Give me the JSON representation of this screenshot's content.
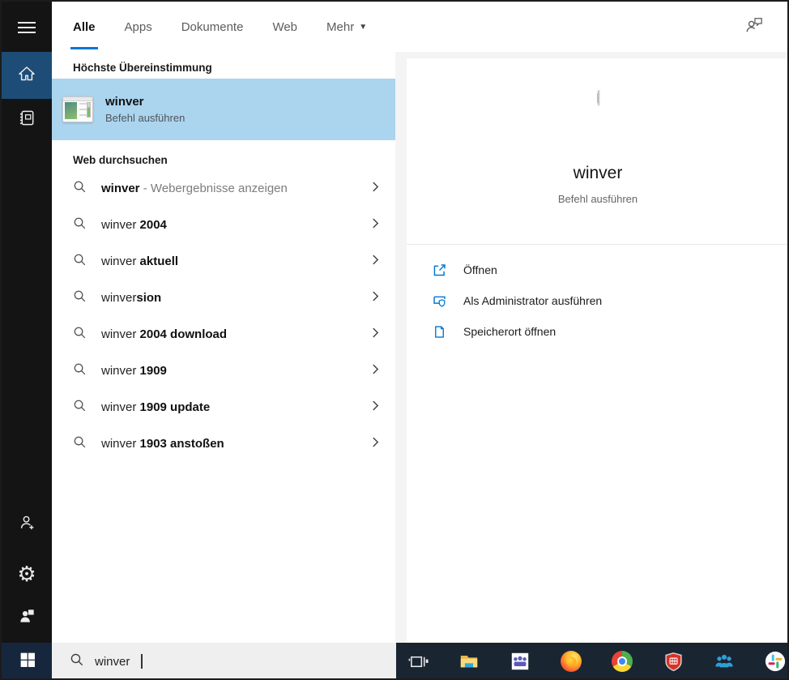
{
  "colors": {
    "accent": "#0078d7",
    "highlight": "#abd4ee",
    "rail_bg": "#141414",
    "home_tile": "#1d4d77",
    "taskbar_bg": "#1a2532",
    "start_tile": "#16273d",
    "panel_bg": "#f4f4f4",
    "action_icon": "#0078d4"
  },
  "tabs": {
    "items": [
      {
        "label": "Alle",
        "active": true,
        "dropdown": false
      },
      {
        "label": "Apps",
        "active": false,
        "dropdown": false
      },
      {
        "label": "Dokumente",
        "active": false,
        "dropdown": false
      },
      {
        "label": "Web",
        "active": false,
        "dropdown": false
      },
      {
        "label": "Mehr",
        "active": false,
        "dropdown": true
      }
    ],
    "feedback_icon": "person-feedback-icon"
  },
  "rail": {
    "icons": [
      "menu-icon",
      "home-icon",
      "journal-icon",
      "person-add-icon",
      "gear-icon",
      "pictures-icon",
      "windows-logo-icon"
    ]
  },
  "left_panel": {
    "best_match_header": "Höchste Übereinstimmung",
    "best_match": {
      "title": "winver",
      "subtitle": "Befehl ausführen",
      "icon": "winver-app-icon"
    },
    "web_section_header": "Web durchsuchen",
    "suggestions": [
      {
        "typed": "",
        "bold": "winver",
        "gray": " - Webergebnisse anzeigen"
      },
      {
        "typed": "winver ",
        "bold": "2004",
        "gray": ""
      },
      {
        "typed": "winver ",
        "bold": "aktuell",
        "gray": ""
      },
      {
        "typed": "winver",
        "bold": "sion",
        "gray": ""
      },
      {
        "typed": "winver ",
        "bold": "2004 download",
        "gray": ""
      },
      {
        "typed": "winver ",
        "bold": "1909",
        "gray": ""
      },
      {
        "typed": "winver ",
        "bold": "1909 update",
        "gray": ""
      },
      {
        "typed": "winver ",
        "bold": "1903 anstoßen",
        "gray": ""
      }
    ]
  },
  "right_panel": {
    "title": "winver",
    "subtitle": "Befehl ausführen",
    "icon": "winver-app-icon",
    "actions": [
      {
        "label": "Öffnen",
        "icon": "open-icon"
      },
      {
        "label": "Als Administrator ausführen",
        "icon": "admin-shield-icon"
      },
      {
        "label": "Speicherort öffnen",
        "icon": "file-location-icon"
      }
    ]
  },
  "search_bar": {
    "query": "winver",
    "icon": "search-icon"
  },
  "taskbar": {
    "icons": [
      "task-view",
      "file-explorer",
      "teams",
      "firefox",
      "chrome",
      "security-shield",
      "contacts",
      "slack"
    ]
  }
}
